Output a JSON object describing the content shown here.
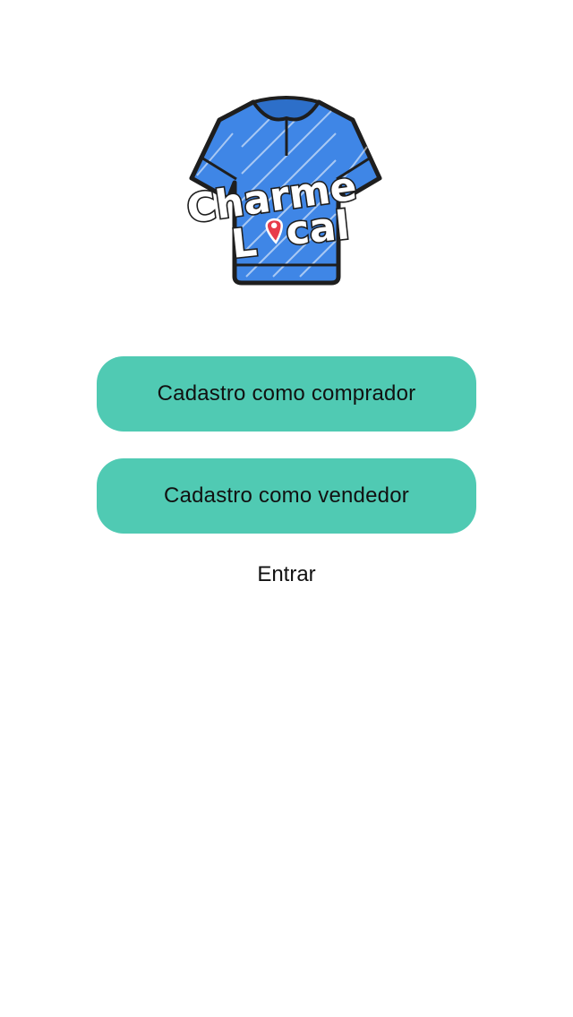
{
  "logo": {
    "icon": "shirt-icon",
    "line1": "Charme",
    "line2_before": "L",
    "line2_after": "cal",
    "pin_icon": "location-pin-icon",
    "colors": {
      "shirt": "#3f86e6",
      "outline": "#1e1e1e",
      "pin": "#e83b4a"
    }
  },
  "actions": {
    "buyer_label": "Cadastro como comprador",
    "seller_label": "Cadastro como vendedor",
    "login_label": "Entrar"
  },
  "theme": {
    "button_color": "#50cab3",
    "background": "#ffffff"
  }
}
